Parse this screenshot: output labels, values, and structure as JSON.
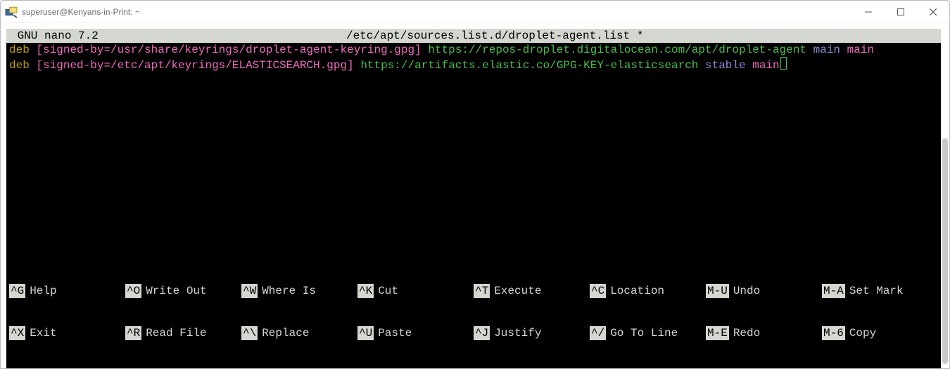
{
  "window": {
    "title": "superuser@Kenyans-in-Print: ~"
  },
  "nano": {
    "app_label": " GNU nano 7.2 ",
    "filename": "/etc/apt/sources.list.d/droplet-agent.list *"
  },
  "file_lines": [
    {
      "deb": "deb",
      "bracket": "[signed-by=/usr/share/keyrings/droplet-agent-keyring.gpg]",
      "url": "https://repos-droplet.digitalocean.com/apt/droplet-agent",
      "suite": "main",
      "component": "main",
      "cursor": false
    },
    {
      "deb": "deb",
      "bracket": "[signed-by=/etc/apt/keyrings/ELASTICSEARCH.gpg]",
      "url": "https://artifacts.elastic.co/GPG-KEY-elasticsearch",
      "suite": "stable",
      "component": "main",
      "cursor": true
    }
  ],
  "shortcuts_row1": [
    {
      "key": "^G",
      "label": "Help"
    },
    {
      "key": "^O",
      "label": "Write Out"
    },
    {
      "key": "^W",
      "label": "Where Is"
    },
    {
      "key": "^K",
      "label": "Cut"
    },
    {
      "key": "^T",
      "label": "Execute"
    },
    {
      "key": "^C",
      "label": "Location"
    },
    {
      "key": "M-U",
      "label": "Undo"
    },
    {
      "key": "M-A",
      "label": "Set Mark"
    }
  ],
  "shortcuts_row2": [
    {
      "key": "^X",
      "label": "Exit"
    },
    {
      "key": "^R",
      "label": "Read File"
    },
    {
      "key": "^\\",
      "label": "Replace"
    },
    {
      "key": "^U",
      "label": "Paste"
    },
    {
      "key": "^J",
      "label": "Justify"
    },
    {
      "key": "^/",
      "label": "Go To Line"
    },
    {
      "key": "M-E",
      "label": "Redo"
    },
    {
      "key": "M-6",
      "label": "Copy"
    }
  ]
}
